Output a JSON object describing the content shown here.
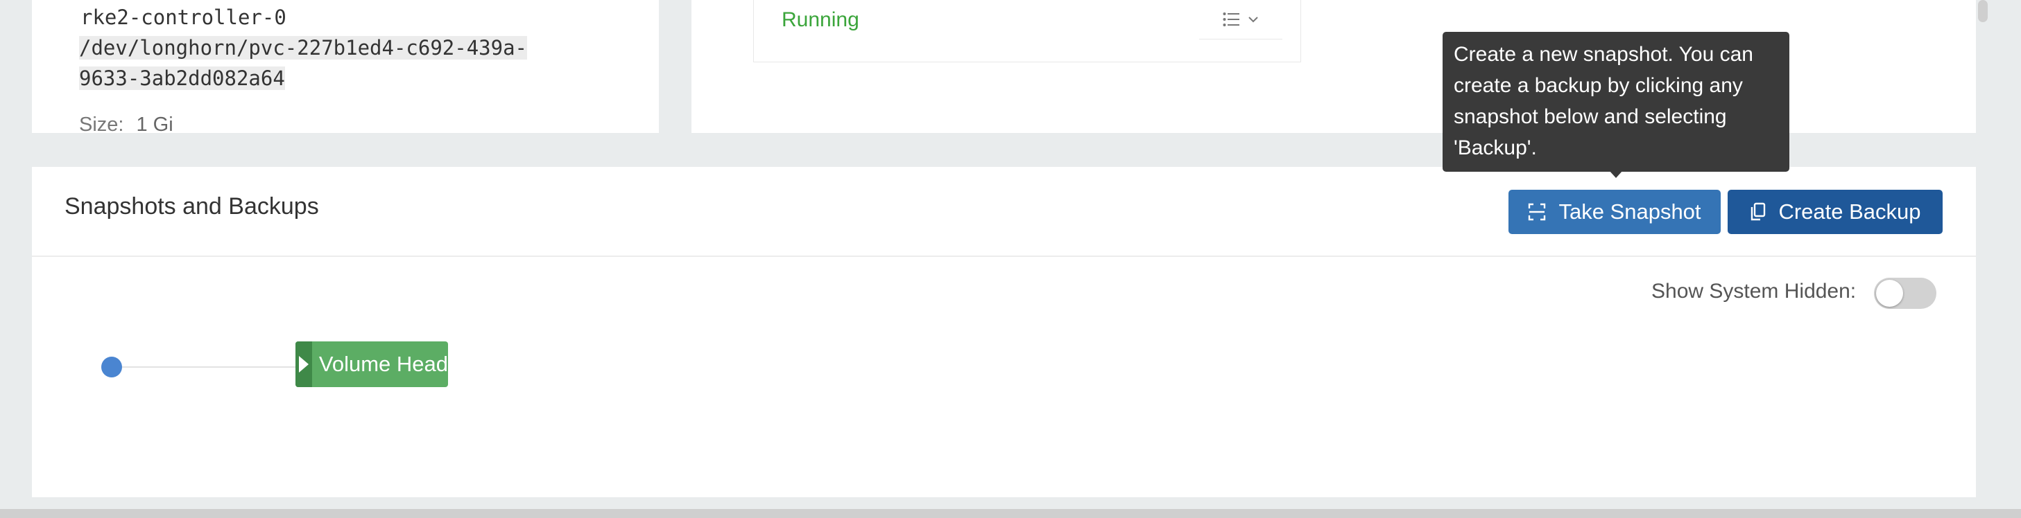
{
  "volume_info": {
    "name": "rke2-controller-0",
    "device_path_line1": "/dev/longhorn/pvc-227b1ed4-c692-439a-",
    "device_path_line2": "9633-3ab2dd082a64",
    "size_label": "Size:",
    "size_value": "1 Gi"
  },
  "status_panel": {
    "state": "Running",
    "list_icon": "list-icon",
    "dropdown_icon": "chevron-down-icon"
  },
  "snapshots": {
    "title": "Snapshots and Backups",
    "take_snapshot_label": "Take Snapshot",
    "create_backup_label": "Create Backup",
    "show_hidden_label": "Show System Hidden:",
    "show_hidden_enabled": false,
    "volume_head_label": "Volume Head"
  },
  "tooltip": {
    "text": "Create a new snapshot. You can create a backup by clicking any snapshot below and selecting 'Backup'."
  },
  "colors": {
    "primary_button": "#3574b5",
    "secondary_button": "#1f5899",
    "running_green": "#3ba53b",
    "volume_head_green": "#5cad64",
    "timeline_dot": "#4a85d1"
  }
}
